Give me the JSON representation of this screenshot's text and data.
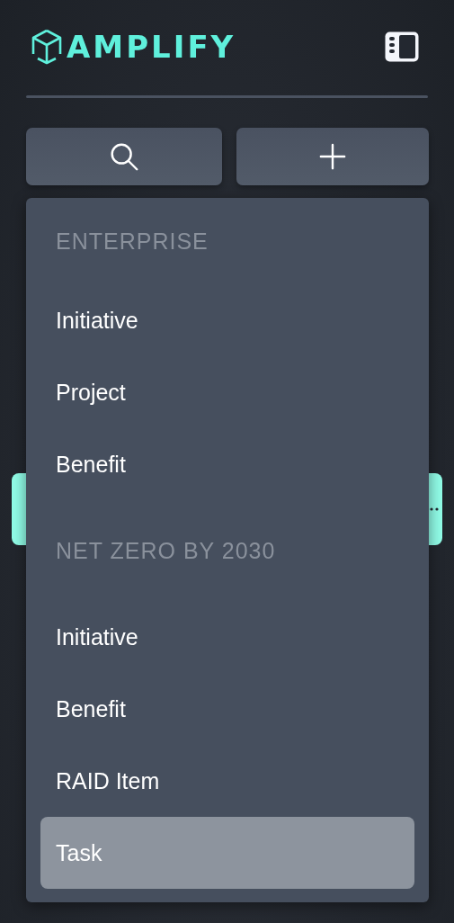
{
  "brand": {
    "name": "AMPLIFY"
  },
  "menu": {
    "sections": [
      {
        "heading": "ENTERPRISE",
        "items": [
          {
            "label": "Initiative",
            "selected": false
          },
          {
            "label": "Project",
            "selected": false
          },
          {
            "label": "Benefit",
            "selected": false
          }
        ]
      },
      {
        "heading": "NET ZERO BY 2030",
        "items": [
          {
            "label": "Initiative",
            "selected": false
          },
          {
            "label": "Benefit",
            "selected": false
          },
          {
            "label": "RAID Item",
            "selected": false
          },
          {
            "label": "Task",
            "selected": true
          }
        ]
      }
    ]
  }
}
